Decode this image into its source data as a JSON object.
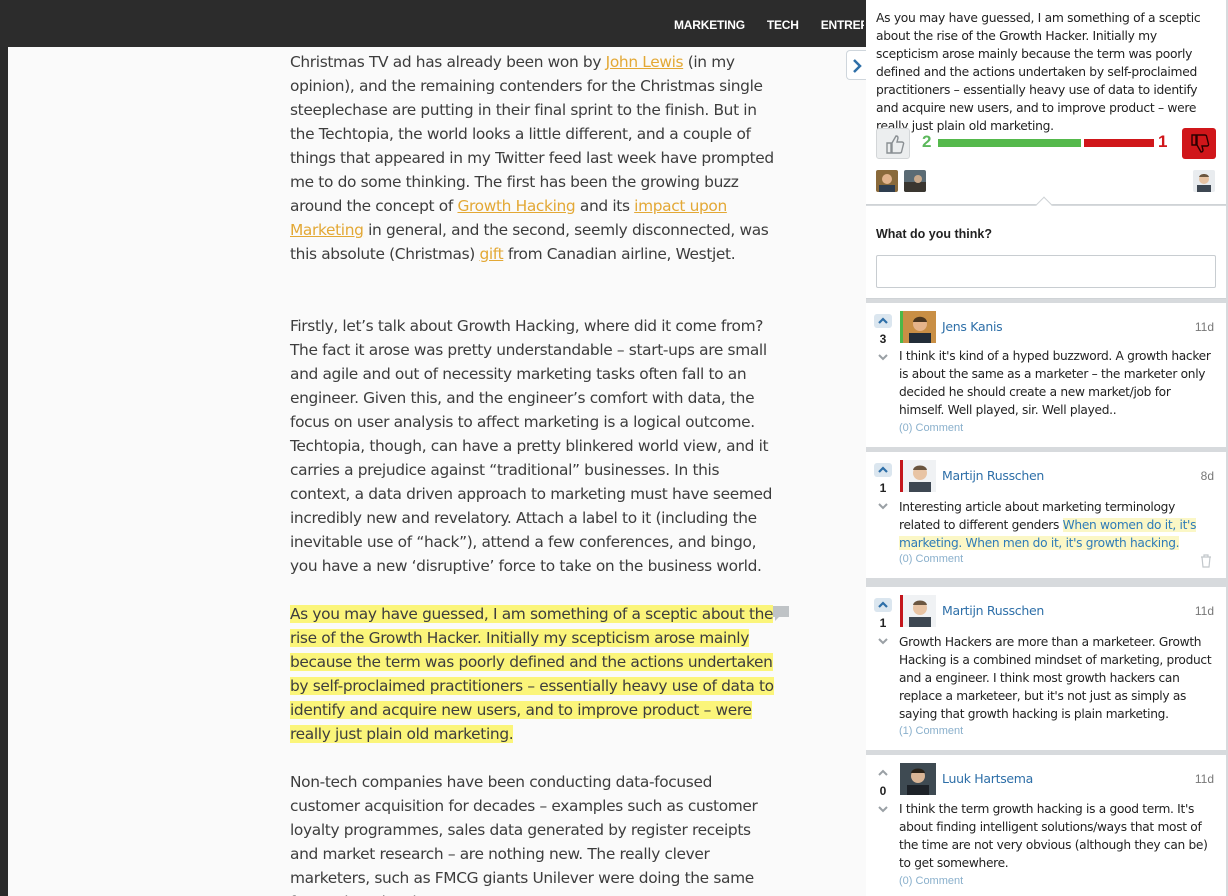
{
  "nav": {
    "items": [
      "MARKETING",
      "TECH",
      "ENTREPRE"
    ]
  },
  "article": {
    "p1_before_link1": "Christmas TV ad has already been won by ",
    "p1_link1": "John Lewis",
    "p1_mid1": " (in my opinion), and the remaining contenders for the Christmas single steeplechase are putting in their final sprint to the finish. But in the Techtopia, the world looks a little different, and a couple of things that appeared in my Twitter feed last week have prompted me to do some thinking. The first has been the growing buzz around the concept of ",
    "p1_link2": "Growth Hacking",
    "p1_mid2": " and its ",
    "p1_link3": "impact upon Marketing",
    "p1_mid3": " in general, and the second, seemly disconnected, was this absolute (Christmas) ",
    "p1_link4": "gift",
    "p1_end": " from Canadian airline, Westjet.",
    "p2": "Firstly, let’s talk about Growth Hacking, where did it come from? The fact it arose was pretty understandable – start-ups are small and agile and out of necessity marketing tasks often fall to an engineer. Given this, and the engineer’s comfort with data, the focus on user analysis to affect marketing is a logical outcome. Techtopia, though, can have a pretty blinkered world view, and it carries a prejudice against “traditional” businesses. In this context, a data driven approach to marketing must have seemed incredibly new and revelatory. Attach a label to it (including the inevitable use of “hack”), attend a few conferences, and bingo, you have a new ‘disruptive’ force to take on the business world.",
    "p3": "As you may have guessed, I am something of a sceptic about the rise of the Growth Hacker. Initially my scepticism arose mainly because the term was poorly defined and the actions undertaken by self-proclaimed practitioners – essentially heavy use of data to identify and acquire new users, and to improve product – were really just plain old marketing.",
    "p4": "Non-tech companies have been conducting data-focused customer acquisition for decades – examples such as customer loyalty programmes, sales data generated by register receipts and market research – are nothing new. The really clever marketers, such as FMCG giants Unilever were doing the same for product development"
  },
  "panel": {
    "quote": "As you may have guessed, I am something of a sceptic about the rise of the Growth Hacker. Initially my scepticism arose mainly because the term was poorly defined and the actions undertaken by self-proclaimed practitioners – essentially heavy use of data to identify and acquire new users, and to improve product – were really just plain old marketing.",
    "up_votes": "2",
    "down_votes": "1",
    "vote_fraction_up": 0.667,
    "ask_label": "What do you think?",
    "ask_placeholder": "",
    "comments": [
      {
        "votes": "3",
        "name": "Jens Kanis",
        "time": "11d",
        "text": "I think it's kind of a hyped buzzword. A growth hacker is about the same as a marketer – the marketer only decided he should create a new market/job for himself. Well played, sir. Well played..",
        "reply": "(0) Comment",
        "marker": "#4cb848"
      },
      {
        "votes": "1",
        "name": "Martijn Russchen",
        "time": "8d",
        "text_before": "Interesting article about marketing terminology related to different genders ",
        "link": "When women do it, it's marketing. When men do it, it's growth hacking.",
        "reply": "(0) Comment",
        "marker": "#c4161c"
      },
      {
        "votes": "1",
        "name": "Martijn Russchen",
        "time": "11d",
        "text": "Growth Hackers are more than a marketeer. Growth Hacking is a combined mindset of marketing, product and a engineer. I think most growth hackers can replace a marketeer, but it's not just as simply as saying that growth hacking is plain marketing.",
        "reply": "(1) Comment",
        "marker": "#c4161c"
      },
      {
        "votes": "0",
        "name": "Luuk Hartsema",
        "time": "11d",
        "text": "I think the term growth hacking is a good term. It's about finding intelligent solutions/ways that most of the time are not very obvious (although they can be) to get somewhere.",
        "reply": "(0) Comment",
        "marker": "none"
      }
    ]
  }
}
